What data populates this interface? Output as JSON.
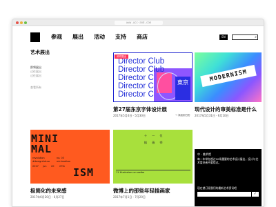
{
  "browser": {
    "url": "www.ucc-and.com"
  },
  "header": {
    "nav": [
      "参观",
      "展出",
      "活动",
      "支持",
      "商店"
    ],
    "lang_label": "EN"
  },
  "sidebar": {
    "title": "艺术展出",
    "items": [
      {
        "label": "即将展出"
      },
      {
        "label": "过往展出"
      },
      {
        "label": "过往展出"
      }
    ],
    "subscribe": "查看所有"
  },
  "cards": [
    {
      "tag": "即将展出",
      "art_lines": [
        "Director Club",
        "Director Club",
        "Director C",
        "Director C",
        "Director C"
      ],
      "badge": "東京",
      "title": "第27届东京字体设计展",
      "date": "2017年5月4日 - 5月30日",
      "add_label": "→ 添加到日历"
    },
    {
      "banner": "MODERNISM",
      "title": "现代设计的审美标准是什么",
      "date": "2017年5月31日 - 6月10日"
    },
    {
      "art_lines": [
        "MINI",
        "MAL",
        "ISM"
      ],
      "small_lines": [
        "revolution",
        "#designfuture",
        "no. 03",
        "minimalism",
        "2017",
        "jun",
        "20",
        "27th"
      ],
      "title": "极简化的未来感",
      "date": "2017年6月20日 - 6月27日"
    },
    {
      "vert_lines": [
        "十 一 位",
        "插 画 师"
      ],
      "caption": "11 illustrators on weibo",
      "title": "微博上的那些年轻插画家",
      "date": "2017年7月1日 - 7月20日"
    }
  ],
  "newsletter": {
    "title": "中 · 美术馆",
    "body": "每一年举办超过20场重要的艺术设计展出，设计与艺术爱好者不要错过。",
    "prompt": "现在就订阅我们的最新艺术资讯吧",
    "input_placeholder": "",
    "submit": "✓"
  },
  "colors": {
    "blue": "#2430d8",
    "orange": "#ff5a1f",
    "lime": "#a8e03c",
    "pink": "#ff2f56"
  }
}
